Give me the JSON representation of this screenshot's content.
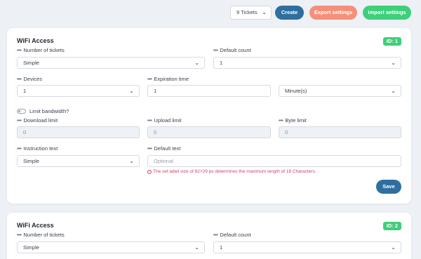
{
  "toolbar": {
    "tickets_select_value": "9 Tickets",
    "create_label": "Create",
    "export_label": "Export settings",
    "import_label": "Import settings"
  },
  "cards": [
    {
      "title": "WiFi Access",
      "id_badge": "ID: 1",
      "number_of_tickets_label": "Number of tickets",
      "number_of_tickets_value": "Simple",
      "default_count_label": "Default count",
      "default_count_value": "1",
      "devices_label": "Devices",
      "devices_value": "1",
      "expiration_label": "Expiration time",
      "expiration_value": "1",
      "expiration_unit": "Minute(s)",
      "bandwidth_label": "Limit bandwidth?",
      "download_label": "Download limit",
      "download_value": "0",
      "upload_label": "Upload limit",
      "upload_value": "0",
      "byte_label": "Byte limit",
      "byte_value": "0",
      "instruction_label": "Instruction text",
      "instruction_value": "Simple",
      "default_text_label": "Default text",
      "default_text_placeholder": "Optional",
      "hint": "The set label size of 62×29 px determines the maximum length of 18 Characters.",
      "save_label": "Save"
    },
    {
      "title": "WiFi Access",
      "id_badge": "ID: 2",
      "number_of_tickets_label": "Number of tickets",
      "number_of_tickets_value": "Simple",
      "default_count_label": "Default count",
      "default_count_value": "1"
    }
  ],
  "icons": {
    "chevron": "chevron-down-icon",
    "dots": "drag-dots-icon",
    "info": "info-circle-icon"
  },
  "colors": {
    "primary": "#2f6f9f",
    "export": "#f4907a",
    "import": "#3ecf7a",
    "hint": "#d1426a"
  }
}
